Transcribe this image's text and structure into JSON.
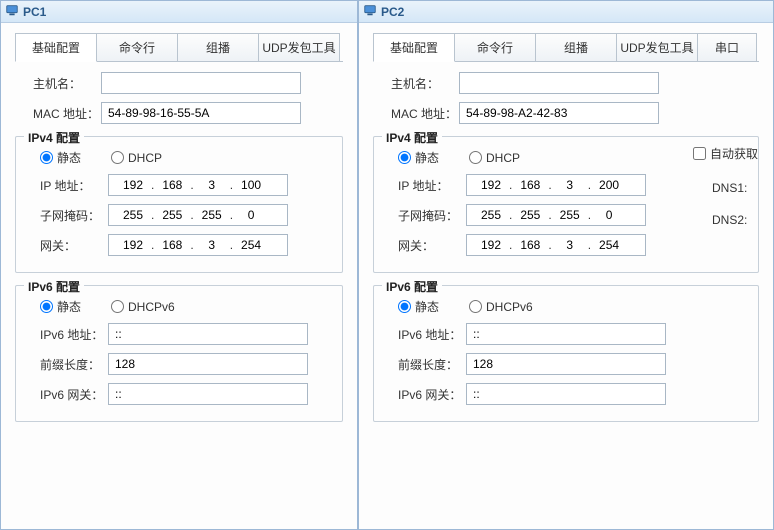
{
  "pc1": {
    "title": "PC1",
    "tabs": [
      "基础配置",
      "命令行",
      "组播",
      "UDP发包工具"
    ],
    "host_label": "主机名：",
    "host_value": "",
    "mac_label": "MAC 地址：",
    "mac_value": "54-89-98-16-55-5A",
    "ipv4": {
      "title": "IPv4 配置",
      "static": "静态",
      "dhcp": "DHCP",
      "ip_label": "IP 地址：",
      "ip": [
        "192",
        "168",
        "3",
        "100"
      ],
      "mask_label": "子网掩码：",
      "mask": [
        "255",
        "255",
        "255",
        "0"
      ],
      "gw_label": "网关：",
      "gw": [
        "192",
        "168",
        "3",
        "254"
      ]
    },
    "ipv6": {
      "title": "IPv6 配置",
      "static": "静态",
      "dhcp": "DHCPv6",
      "addr_label": "IPv6 地址：",
      "addr": "::",
      "prefix_label": "前缀长度：",
      "prefix": "128",
      "gw_label": "IPv6 网关：",
      "gw": "::"
    }
  },
  "pc2": {
    "title": "PC2",
    "tabs": [
      "基础配置",
      "命令行",
      "组播",
      "UDP发包工具",
      "串口"
    ],
    "host_label": "主机名：",
    "host_value": "",
    "mac_label": "MAC 地址：",
    "mac_value": "54-89-98-A2-42-83",
    "ipv4": {
      "title": "IPv4 配置",
      "static": "静态",
      "dhcp": "DHCP",
      "autoget": "自动获取",
      "ip_label": "IP 地址：",
      "ip": [
        "192",
        "168",
        "3",
        "200"
      ],
      "mask_label": "子网掩码：",
      "mask": [
        "255",
        "255",
        "255",
        "0"
      ],
      "gw_label": "网关：",
      "gw": [
        "192",
        "168",
        "3",
        "254"
      ],
      "dns1_label": "DNS1:",
      "dns2_label": "DNS2:"
    },
    "ipv6": {
      "title": "IPv6 配置",
      "static": "静态",
      "dhcp": "DHCPv6",
      "addr_label": "IPv6 地址：",
      "addr": "::",
      "prefix_label": "前缀长度：",
      "prefix": "128",
      "gw_label": "IPv6 网关：",
      "gw": "::"
    }
  }
}
